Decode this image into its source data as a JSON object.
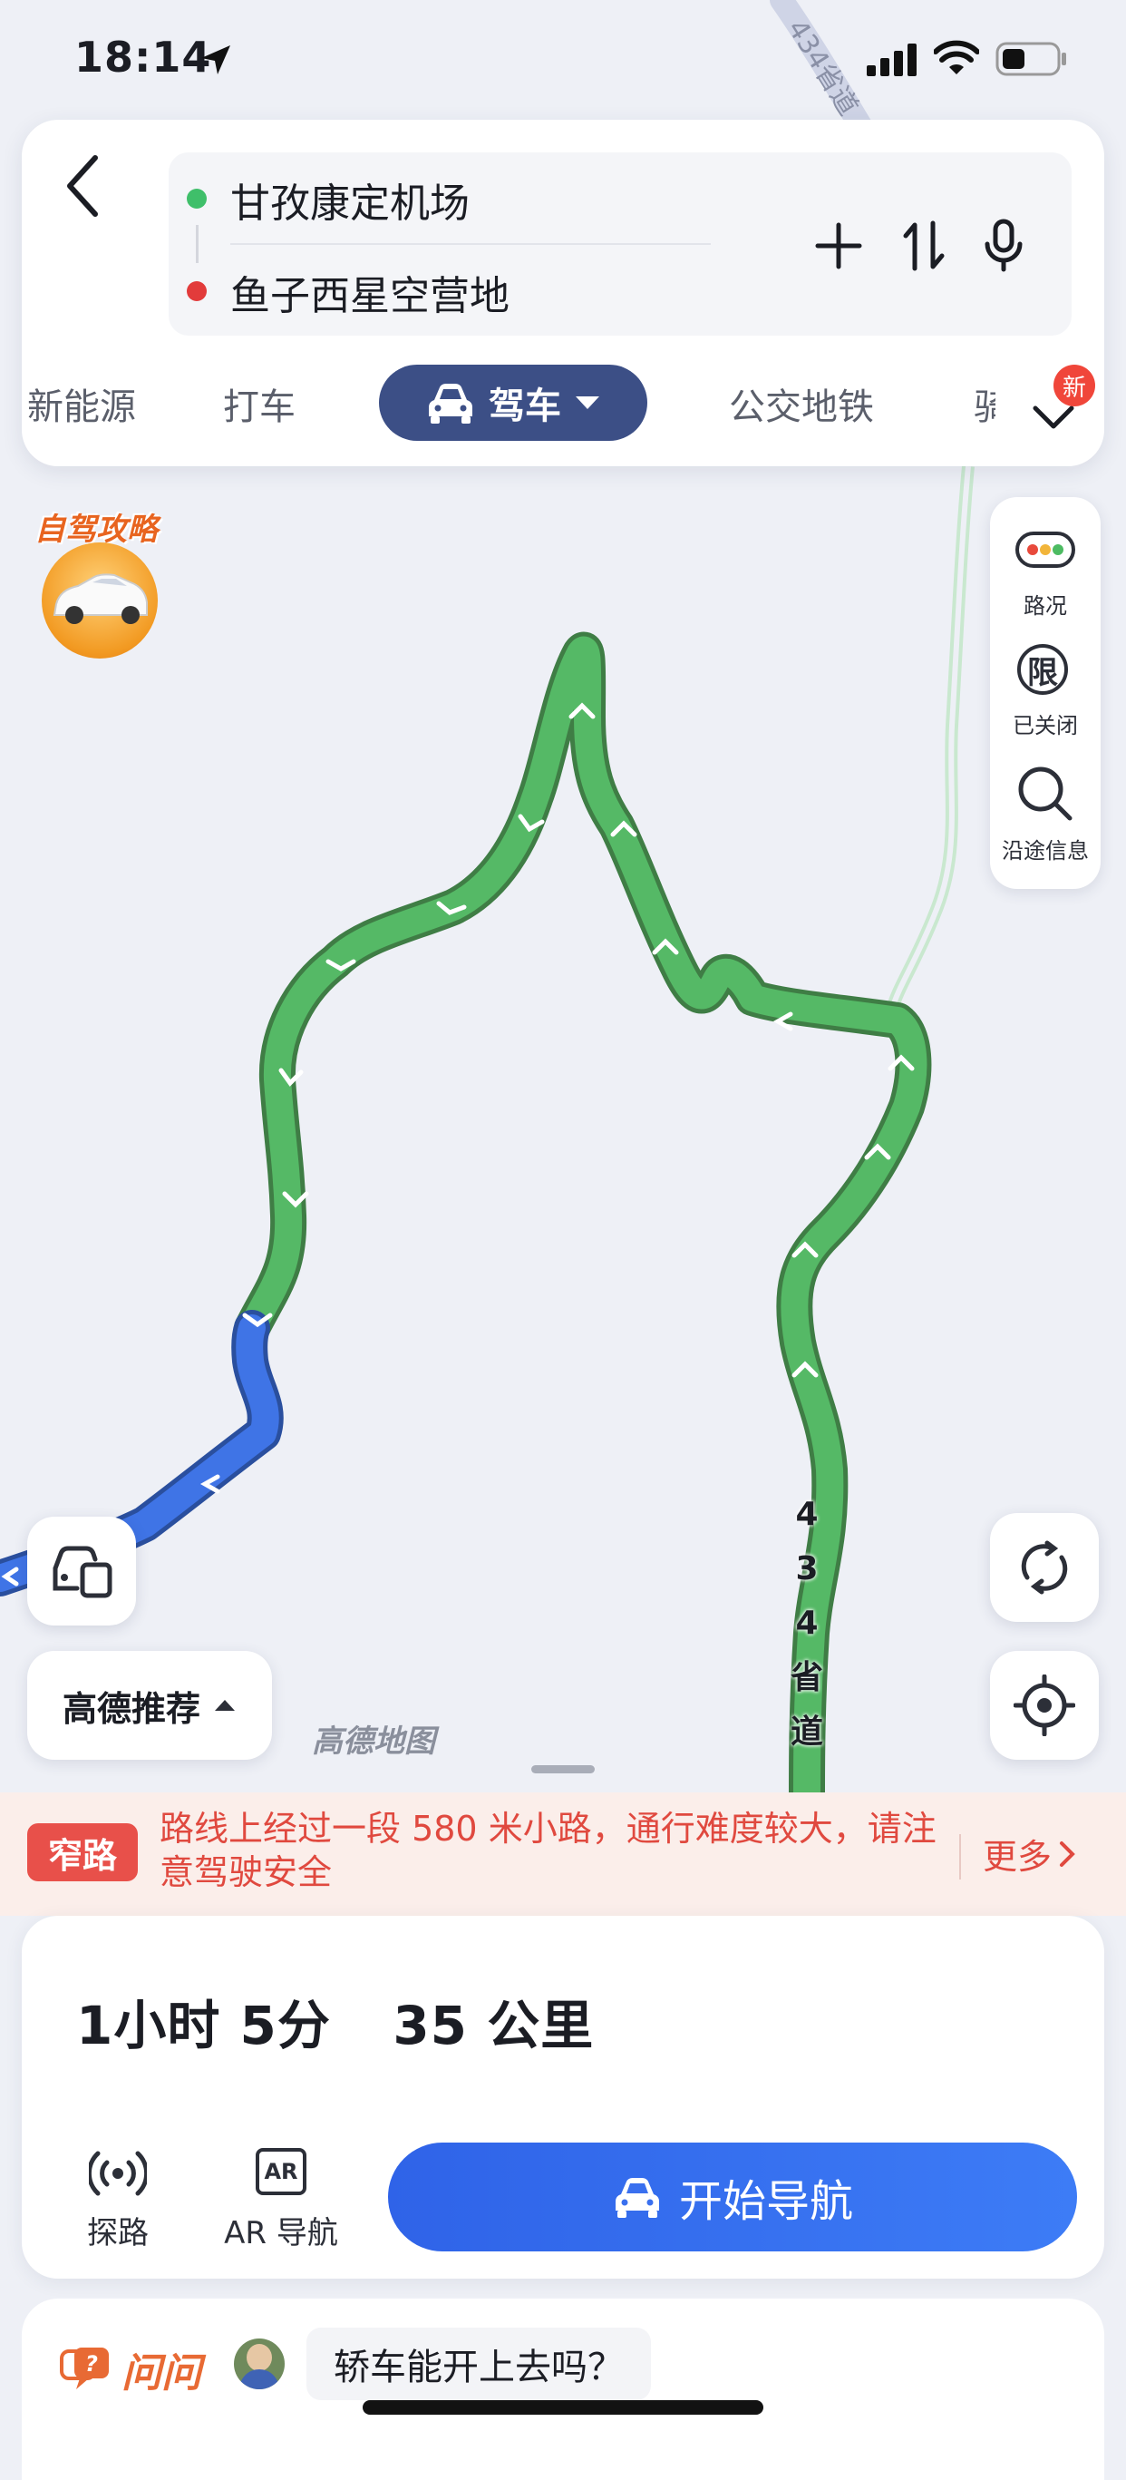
{
  "status_bar": {
    "time": "18:14"
  },
  "route": {
    "origin": "甘孜康定机场",
    "destination": "鱼子西星空营地"
  },
  "tabs": {
    "items": [
      "新能源",
      "打车",
      "驾车",
      "公交地铁",
      "骑"
    ],
    "active": "驾车",
    "more_badge": "新"
  },
  "map": {
    "promo_label": "自驾攻略",
    "road_label": [
      "4",
      "3",
      "4",
      "省",
      "道"
    ],
    "top_road_label": "434省道",
    "watermark": "高德地图"
  },
  "tools": {
    "traffic": "路况",
    "restriction": "已关闭",
    "along_route": "沿途信息",
    "restriction_glyph": "限"
  },
  "recommend": {
    "label": "高德推荐"
  },
  "warning": {
    "tag": "窄路",
    "text": "路线上经过一段 580 米小路，通行难度较大，请注意驾驶安全",
    "more": "更多"
  },
  "summary": {
    "duration": "1小时 5分",
    "distance": "35 公里"
  },
  "actions": {
    "explore": "探路",
    "ar_nav": "AR 导航",
    "ar_glyph": "AR",
    "start_nav": "开始导航"
  },
  "ask": {
    "logo": "问问",
    "question": "轿车能开上去吗？"
  },
  "colors": {
    "route_green": "#55b966",
    "route_blue": "#3f74e6",
    "accent_blue": "#2f63e8",
    "tab_active": "#3c4f86",
    "warning_red": "#e0493f"
  }
}
